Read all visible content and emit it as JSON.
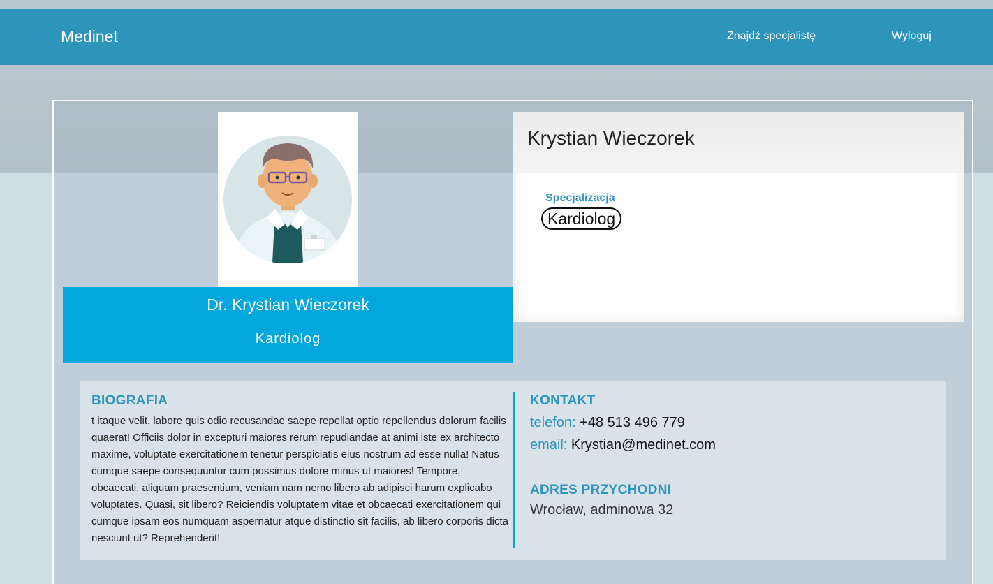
{
  "navbar": {
    "brand": "Medinet",
    "links": [
      "Znajdź specjalistę",
      "Wyloguj"
    ]
  },
  "profile": {
    "card_name": "Dr. Krystian Wieczorek",
    "card_specialization": "Kardiolog",
    "panel_name": "Krystian Wieczorek",
    "specialization_label": "Specjalizacja",
    "specialization_value": "Kardiolog"
  },
  "biography": {
    "title": "BIOGRAFIA",
    "text": "t itaque velit, labore quis odio recusandae saepe repellat optio repellendus dolorum facilis quaerat! Officiis dolor in excepturi maiores rerum repudiandae at animi iste ex architecto maxime, voluptate exercitationem tenetur perspiciatis eius nostrum ad esse nulla! Natus cumque saepe consequuntur cum possimus dolore minus ut maiores! Tempore, obcaecati, aliquam praesentium, veniam nam nemo libero ab adipisci harum explicabo voluptates. Quasi, sit libero? Reiciendis voluptatem vitae et obcaecati exercitationem qui cumque ipsam eos numquam aspernatur atque distinctio sit facilis, ab libero corporis dicta nesciunt ut? Reprehenderit!"
  },
  "contact": {
    "title": "KONTAKT",
    "phone_label": "telefon:",
    "phone_value": "+48 513 496 779",
    "email_label": "email:",
    "email_value": "Krystian@medinet.com"
  },
  "address": {
    "title": "ADRES PRZYCHODNI",
    "value": "Wrocław, adminowa 32"
  },
  "colors": {
    "navbar": "#2d94bc",
    "accent": "#02a7de",
    "heading": "#2d94bc"
  },
  "icons": {
    "avatar": "doctor-avatar-icon"
  }
}
